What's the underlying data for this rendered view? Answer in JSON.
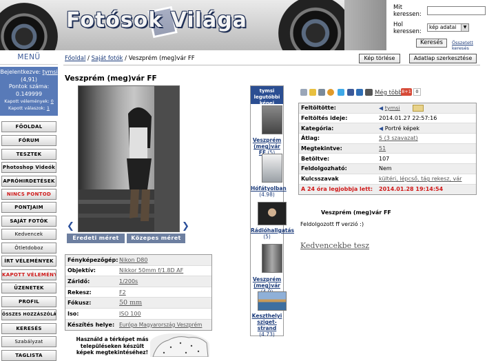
{
  "header": {
    "logo": "Fotósok Világa",
    "search_label": "Mit keressen:",
    "where_label": "Hol keressen:",
    "where_value": "kép adatai",
    "search_button": "Keresés",
    "advanced_link": "Összetett keresés"
  },
  "sidebar": {
    "title": "MENÜ",
    "login_label": "Bejelentkezve:",
    "username": "tymsi",
    "rating": "(4,91)",
    "points_label": "Pontok száma:",
    "points": "0.149999",
    "comments_received_label": "Kapott vélemények:",
    "comments_received": "0",
    "replies_received_label": "Kapott válaszok:",
    "replies_received": "1",
    "items": [
      {
        "label": "FŐOLDAL"
      },
      {
        "label": "FÓRUM"
      },
      {
        "label": "TESZTEK"
      },
      {
        "label": "Photoshop Videók"
      },
      {
        "label": "APRÓHIRDETÉSEK"
      },
      {
        "label": "NINCS PONTOD"
      },
      {
        "label": "PONTJAIM"
      },
      {
        "label": "SAJÁT FOTÓK"
      },
      {
        "label": "Kedvencek"
      },
      {
        "label": "Ötletdoboz"
      },
      {
        "label": "ÍRT VÉLEMÉNYEK"
      },
      {
        "label": "KAPOTT VÉLEMÉNYEK"
      },
      {
        "label": "ÜZENETEK"
      },
      {
        "label": "PROFIL"
      },
      {
        "label": "ÖSSZES HOZZÁSZÓLÁS"
      },
      {
        "label": "KERESÉS"
      },
      {
        "label": "Szabályzat"
      },
      {
        "label": "TAGLISTA"
      }
    ]
  },
  "breadcrumb": {
    "home": "Főoldal",
    "sep1": " / ",
    "mine": "Saját fotók",
    "sep2": " / ",
    "current": "Veszprém (meg)vár FF"
  },
  "actions": {
    "delete": "Kép törlése",
    "edit": "Adatlap szerkesztése"
  },
  "photo": {
    "title": "Veszprém (meg)vár FF",
    "original_size": "Eredeti méret",
    "medium_size": "Közepes méret"
  },
  "exif": [
    {
      "key": "Fényképezőgép:",
      "value": "Nikon D80"
    },
    {
      "key": "Objektív:",
      "value": "Nikkor 50mm f/1.8D AF"
    },
    {
      "key": "Záridő:",
      "value": "1/200s"
    },
    {
      "key": "Rekesz:",
      "value": "F2"
    },
    {
      "key": "Fókusz:",
      "value": "50 mm"
    },
    {
      "key": "Iso:",
      "value": "ISO 100"
    },
    {
      "key": "Készítés helye:",
      "value": "Európa Magyarország Veszprém"
    }
  ],
  "map_text": "Használd a térképet más településeken készült képek megtekintéséhez!",
  "top_photos": {
    "title": "tymsi legutóbbi képei",
    "items": [
      {
        "name": "Veszprém (meg)vár FF",
        "score": "(5)"
      },
      {
        "name": "Hófátyolban",
        "score": "(4.98)"
      },
      {
        "name": "Rádióhallgatás",
        "score": "(5)"
      },
      {
        "name": "Veszprém (meg)vár",
        "score": "(4.9)"
      },
      {
        "name": "Keszthelyi sziget-strand",
        "score": "(4.73)"
      }
    ]
  },
  "social": {
    "more": "Még több",
    "gplus": "8+1",
    "count": "0"
  },
  "info": [
    {
      "key": "Feltöltötte:",
      "value": "tymsi"
    },
    {
      "key": "Feltöltés ideje:",
      "value": "2014.01.27 22:57:16"
    },
    {
      "key": "Kategória:",
      "value": "Portré képek"
    },
    {
      "key": "Átlag:",
      "value": "5 (3 szavazat)"
    },
    {
      "key": "Megtekintve:",
      "value": "51"
    },
    {
      "key": "Betöltve:",
      "value": "107"
    },
    {
      "key": "Feldolgozható:",
      "value": "Nem"
    },
    {
      "key": "Kulcsszavak",
      "value": "kültéri, lépcső, tág rekesz, vár"
    },
    {
      "key": "A 24 óra legjobbja lett:",
      "value": "2014.01.28 19:14:54"
    }
  ],
  "photo_name": "Veszprém (meg)vár FF",
  "photo_desc": "Feldolgozott ff verzió :)",
  "favorite_link": "Kedvencekbe tesz"
}
